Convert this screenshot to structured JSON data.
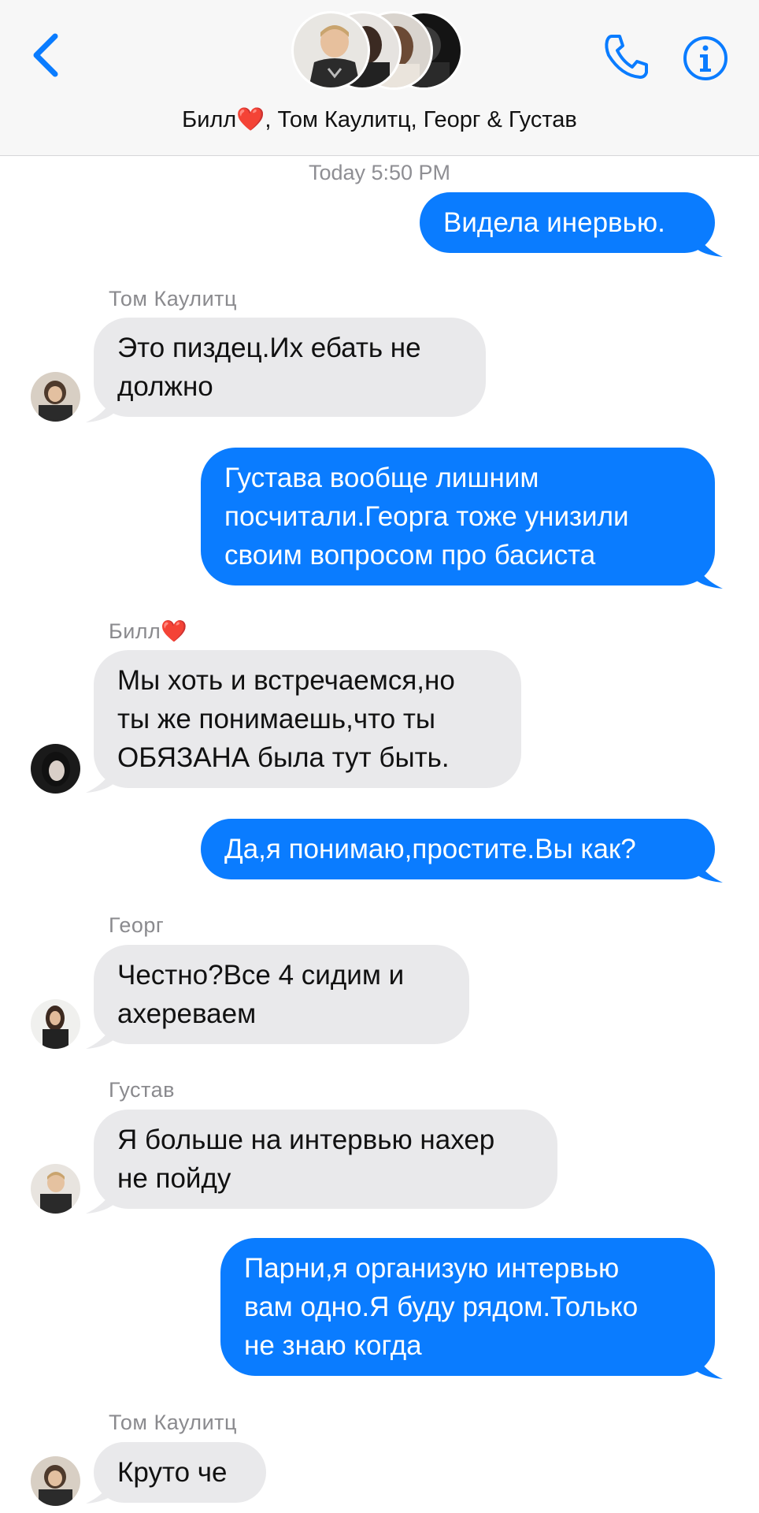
{
  "header": {
    "back_icon": "chevron-left-icon",
    "title_prefix": "Билл",
    "title_heart": "❤️",
    "title_rest": ", Том Каулитц, Георг & Густав",
    "phone_icon": "phone-icon",
    "info_icon": "info-icon"
  },
  "colors": {
    "outgoing_bubble": "#0a7cff",
    "incoming_bubble": "#e9e9eb",
    "accent": "#0a7cff"
  },
  "timestamp": "Today 5:50 PM",
  "messages": [
    {
      "from": "me",
      "text": "Видела инервью."
    },
    {
      "from": "Том Каулитц",
      "text": "Это пиздец.Их ебать не\nдолжно"
    },
    {
      "from": "me",
      "text": "Густава вообще лишним\nпосчитали.Георга тоже унизили\nсвоим вопросом про басиста"
    },
    {
      "from": "Билл",
      "heart": "❤️",
      "text": "Мы хоть и встречаемся,но\nты же понимаешь,что ты\nОБЯЗАНА была тут быть."
    },
    {
      "from": "me",
      "text": "Да,я понимаю,простите.Вы как?"
    },
    {
      "from": "Георг",
      "text": "Честно?Все 4 сидим и\nахереваем"
    },
    {
      "from": "Густав",
      "text": "Я больше на интервью нахер\nне пойду"
    },
    {
      "from": "me",
      "text": "Парни,я организую интервью\nвам одно.Я буду рядом.Только\nне знаю когда"
    },
    {
      "from": "Том Каулитц",
      "text": "Круто че"
    }
  ]
}
